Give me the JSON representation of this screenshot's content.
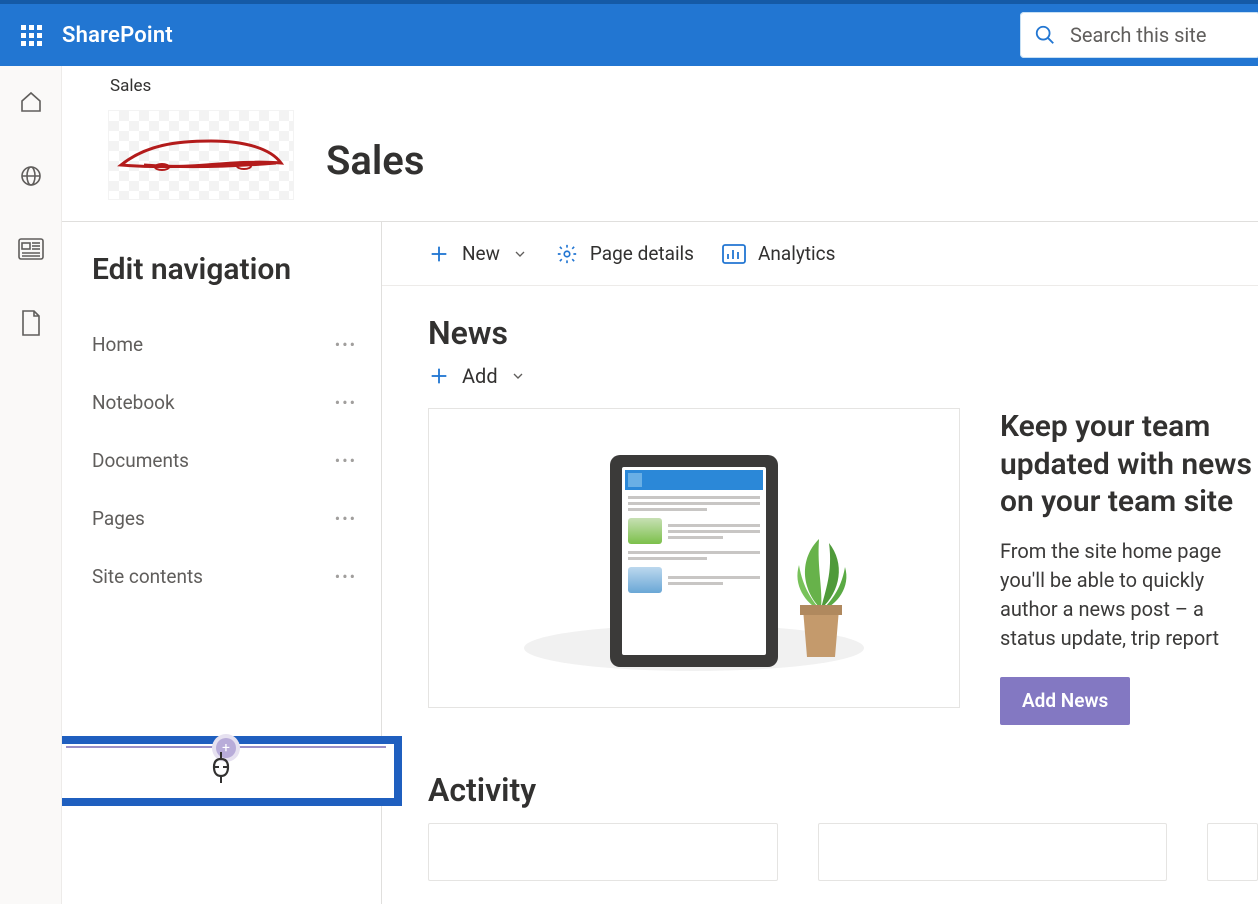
{
  "suite": {
    "brand": "SharePoint",
    "search_placeholder": "Search this site"
  },
  "site": {
    "breadcrumb": "Sales",
    "title": "Sales"
  },
  "nav": {
    "heading": "Edit navigation",
    "items": [
      {
        "label": "Home"
      },
      {
        "label": "Notebook"
      },
      {
        "label": "Documents"
      },
      {
        "label": "Pages"
      },
      {
        "label": "Site contents"
      }
    ]
  },
  "commands": {
    "new_label": "New",
    "page_details_label": "Page details",
    "analytics_label": "Analytics"
  },
  "news": {
    "section_title": "News",
    "add_label": "Add",
    "headline": "Keep your team updated with news on your team site",
    "body": "From the site home page you'll be able to quickly author a news post – a status update, trip report",
    "button_label": "Add News"
  },
  "activity": {
    "section_title": "Activity"
  }
}
